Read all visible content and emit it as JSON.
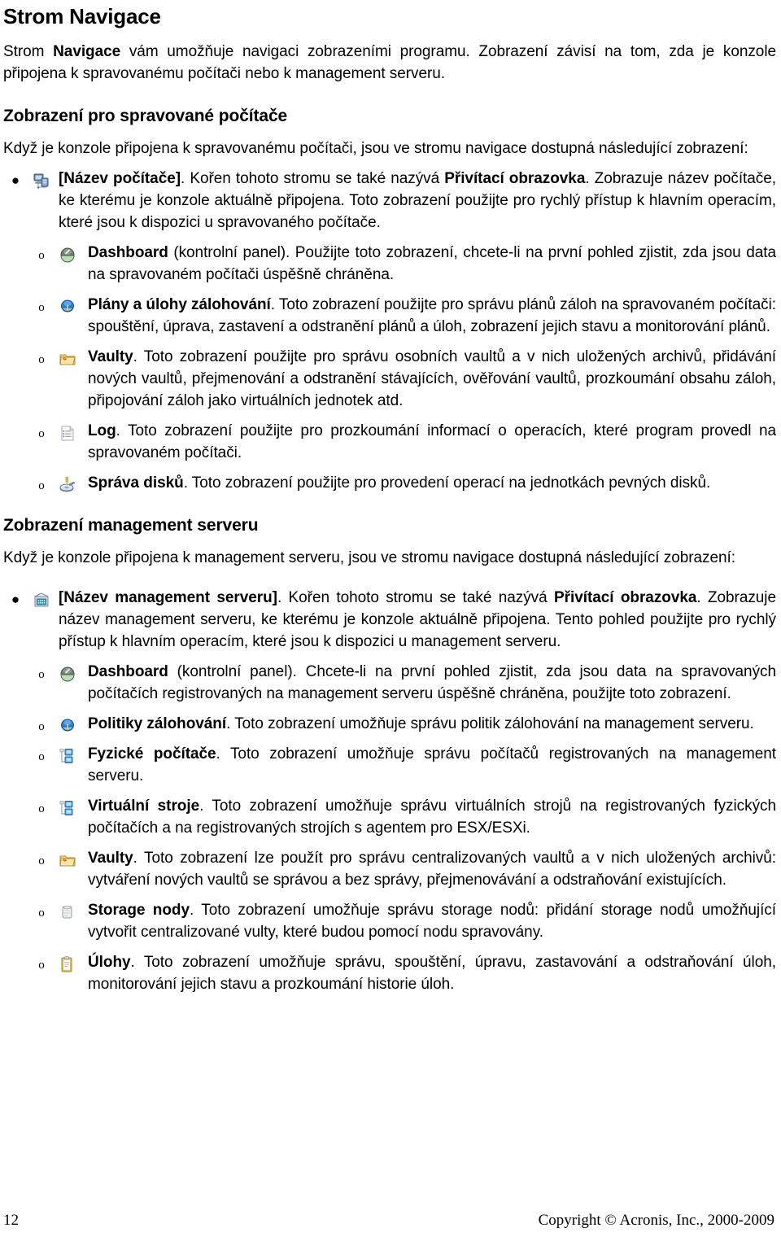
{
  "document": {
    "title": "Strom Navigace",
    "intro": {
      "pre": "Strom ",
      "bold": "Navigace",
      "post": " vám umožňuje navigaci zobrazeními programu. Zobrazení závisí na tom, zda je konzole připojena k spravovanému počítači nebo k management serveru."
    },
    "section1": {
      "heading": "Zobrazení pro spravované počítače",
      "lead": "Když je konzole připojena k spravovanému počítači, jsou ve stromu navigace dostupná následující zobrazení:",
      "items": [
        {
          "icon": "computer-icon",
          "level": 1,
          "bold_lead": "[Název počítače]",
          "text_mid": ". Kořen tohoto stromu se také nazývá ",
          "bold_mid": "Přivítací obrazovka",
          "text_rest": ". Zobrazuje název počítače, ke kterému je konzole aktuálně připojena. Toto zobrazení použijte pro rychlý přístup k hlavním operacím, které jsou k dispozici u spravovaného počítače."
        },
        {
          "icon": "dashboard-icon",
          "level": 2,
          "bold_lead": "Dashboard",
          "text_rest": " (kontrolní panel). Použijte toto zobrazení, chcete-li na první pohled zjistit, zda jsou data na spravovaném počítači úspěšně chráněna."
        },
        {
          "icon": "backup-plans-icon",
          "level": 2,
          "bold_lead": "Plány a úlohy zálohování",
          "text_rest": ". Toto zobrazení použijte pro správu plánů záloh na spravovaném počítači: spouštění, úprava, zastavení a odstranění plánů a úloh, zobrazení jejich stavu a monitorování plánů."
        },
        {
          "icon": "vault-folder-icon",
          "level": 2,
          "bold_lead": "Vaulty",
          "text_rest": ". Toto zobrazení použijte pro správu osobních vaultů a v nich uložených archivů, přidávání nových vaultů, přejmenování a odstranění stávajících, ověřování vaultů, prozkoumání obsahu záloh, připojování záloh jako virtuálních jednotek atd."
        },
        {
          "icon": "log-icon",
          "level": 2,
          "bold_lead": "Log",
          "text_rest": ". Toto zobrazení použijte pro prozkoumání informací o operacích, které program provedl na spravovaném počítači."
        },
        {
          "icon": "disk-management-icon",
          "level": 2,
          "bold_lead": "Správa disků",
          "text_rest": ". Toto zobrazení použijte pro provedení operací na jednotkách pevných disků."
        }
      ]
    },
    "section2": {
      "heading": "Zobrazení management serveru",
      "lead": "Když je konzole připojena k management serveru, jsou ve stromu navigace dostupná následující zobrazení:",
      "items": [
        {
          "icon": "management-server-icon",
          "level": 1,
          "bold_lead": "[Název management serveru]",
          "text_mid": ". Kořen tohoto stromu se také nazývá ",
          "bold_mid": "Přivítací obrazovka",
          "text_rest": ". Zobrazuje název management serveru, ke kterému je konzole aktuálně připojena. Tento pohled použijte pro rychlý přístup k hlavním operacím, které jsou k dispozici u management serveru."
        },
        {
          "icon": "dashboard-icon",
          "level": 2,
          "bold_lead": "Dashboard",
          "text_rest": " (kontrolní panel). Chcete-li na první pohled zjistit, zda jsou data na spravovaných počítačích registrovaných na management serveru úspěšně chráněna, použijte toto zobrazení."
        },
        {
          "icon": "backup-policies-icon",
          "level": 2,
          "bold_lead": "Politiky zálohování",
          "text_rest": ". Toto zobrazení umožňuje správu politik zálohování na management serveru."
        },
        {
          "icon": "physical-machines-icon",
          "level": 2,
          "bold_lead": "Fyzické počítače",
          "text_rest": ". Toto zobrazení umožňuje správu počítačů registrovaných na management serveru."
        },
        {
          "icon": "virtual-machines-icon",
          "level": 2,
          "bold_lead": "Virtuální stroje",
          "text_rest": ". Toto zobrazení umožňuje správu virtuálních strojů na registrovaných fyzických počítačích a na registrovaných strojích s agentem pro ESX/ESXi."
        },
        {
          "icon": "vault-folder-icon",
          "level": 2,
          "bold_lead": "Vaulty",
          "text_rest": ". Toto zobrazení lze použít pro správu centralizovaných vaultů a v nich uložených archivů: vytváření nových vaultů se správou a bez správy, přejmenovávání a odstraňování existujících."
        },
        {
          "icon": "storage-node-icon",
          "level": 2,
          "bold_lead": "Storage nody",
          "text_rest": ". Toto zobrazení umožňuje správu storage nodů: přidání storage nodů umožňující vytvořit centralizované vulty, které budou pomocí nodu spravovány."
        },
        {
          "icon": "tasks-icon",
          "level": 2,
          "bold_lead": "Úlohy",
          "text_rest": ". Toto zobrazení umožňuje správu, spouštění, úpravu, zastavování a odstraňování úloh, monitorování jejich stavu a prozkoumání historie úloh."
        }
      ]
    },
    "footer": {
      "page_number": "12",
      "copyright": "Copyright © Acronis, Inc., 2000-2009"
    },
    "bullets": {
      "level1_marker": "●",
      "level2_marker": "o"
    }
  }
}
